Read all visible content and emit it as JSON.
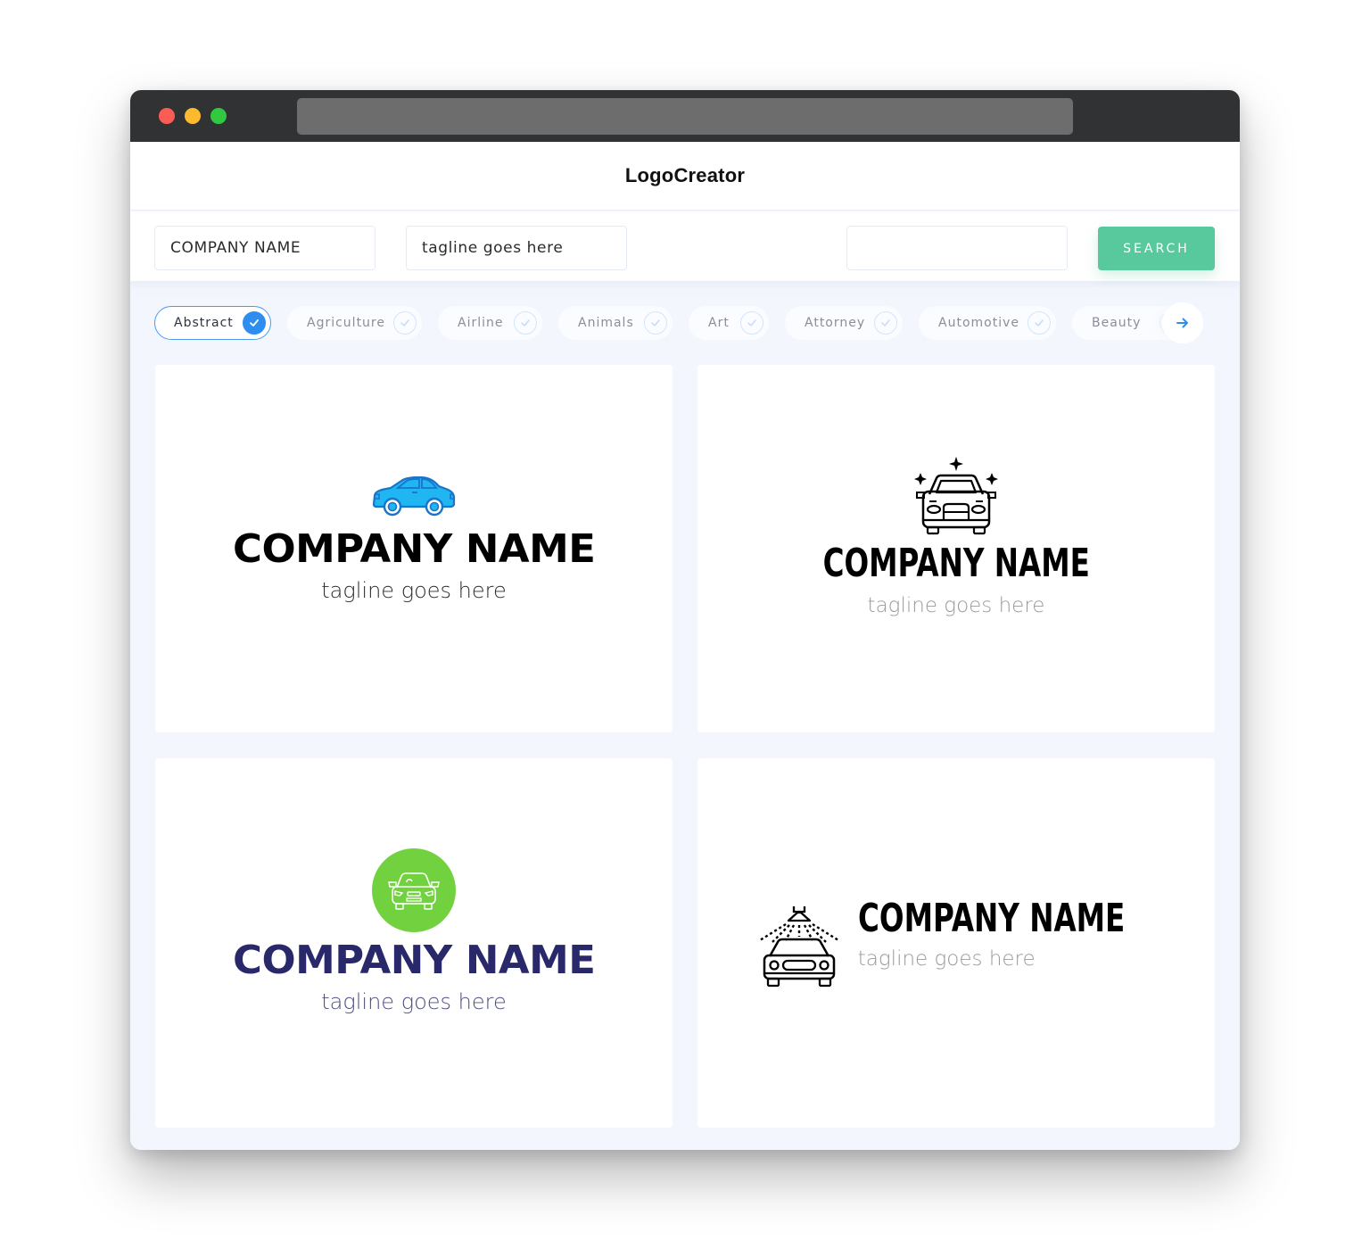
{
  "window": {
    "controls": [
      "close",
      "minimize",
      "maximize"
    ],
    "address_bar": ""
  },
  "header": {
    "title": "LogoCreator"
  },
  "search": {
    "company_name_value": "COMPANY NAME",
    "tagline_value": "tagline goes here",
    "extra_value": "",
    "button_label": "SEARCH"
  },
  "categories": {
    "items": [
      {
        "label": "Abstract",
        "selected": true
      },
      {
        "label": "Agriculture",
        "selected": false
      },
      {
        "label": "Airline",
        "selected": false
      },
      {
        "label": "Animals",
        "selected": false
      },
      {
        "label": "Art",
        "selected": false
      },
      {
        "label": "Attorney",
        "selected": false
      },
      {
        "label": "Automotive",
        "selected": false
      },
      {
        "label": "Beauty",
        "selected": false
      }
    ],
    "next_icon": "arrow-right-icon"
  },
  "colors": {
    "accent_green": "#58c89d",
    "accent_blue": "#2e8ef0",
    "car_blue": "#1fb6f2",
    "circle_green": "#72d13f",
    "navy": "#29286a"
  },
  "logos": [
    {
      "icon": "car-side-icon",
      "company": "COMPANY NAME",
      "tagline": "tagline goes here"
    },
    {
      "icon": "car-sparkle-icon",
      "company": "COMPANY NAME",
      "tagline": "tagline goes here"
    },
    {
      "icon": "car-front-circle-icon",
      "company": "COMPANY NAME",
      "tagline": "tagline goes here"
    },
    {
      "icon": "car-wash-icon",
      "company": "COMPANY NAME",
      "tagline": "tagline goes here"
    }
  ]
}
